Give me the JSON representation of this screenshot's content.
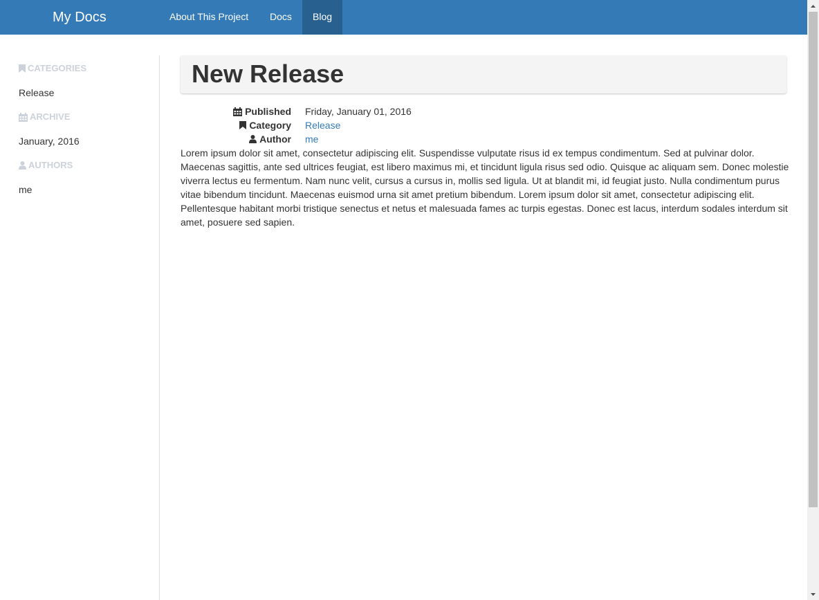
{
  "navbar": {
    "brand": "My Docs",
    "items": [
      {
        "label": "About This Project"
      },
      {
        "label": "Docs"
      },
      {
        "label": "Blog"
      }
    ],
    "color": "#337ab7",
    "active_color": "#286090"
  },
  "sidebar": {
    "categories_heading": "CATEGORIES",
    "categories": [
      "Release"
    ],
    "archive_heading": "ARCHIVE",
    "archive": [
      "January, 2016"
    ],
    "authors_heading": "AUTHORS",
    "authors": [
      "me"
    ]
  },
  "post": {
    "title": "New Release",
    "published_label": "Published",
    "published_value": "Friday, January 01, 2016",
    "category_label": "Category",
    "category_value": "Release",
    "author_label": "Author",
    "author_value": "me",
    "body": "Lorem ipsum dolor sit amet, consectetur adipiscing elit. Suspendisse vulputate risus id ex tempus condimentum. Sed at pulvinar dolor. Maecenas sagittis, ante sed ultrices feugiat, est libero maximus mi, et tincidunt ligula risus sed odio. Quisque ac aliquam sem. Donec molestie viverra lectus eu fermentum. Nam nunc velit, cursus a cursus in, mollis sed ligula. Ut at blandit mi, id feugiat justo. Nulla condimentum purus vitae bibendum tincidunt. Maecenas euismod urna sit amet pretium bibendum. Lorem ipsum dolor sit amet, consectetur adipiscing elit. Pellentesque habitant morbi tristique senectus et netus et malesuada fames ac turpis egestas. Donec est lacus, interdum sodales interdum sit amet, posuere sed sapien."
  },
  "icons": {
    "categories": "bookmark-icon",
    "archive": "calendar-icon",
    "authors": "user-icon"
  }
}
